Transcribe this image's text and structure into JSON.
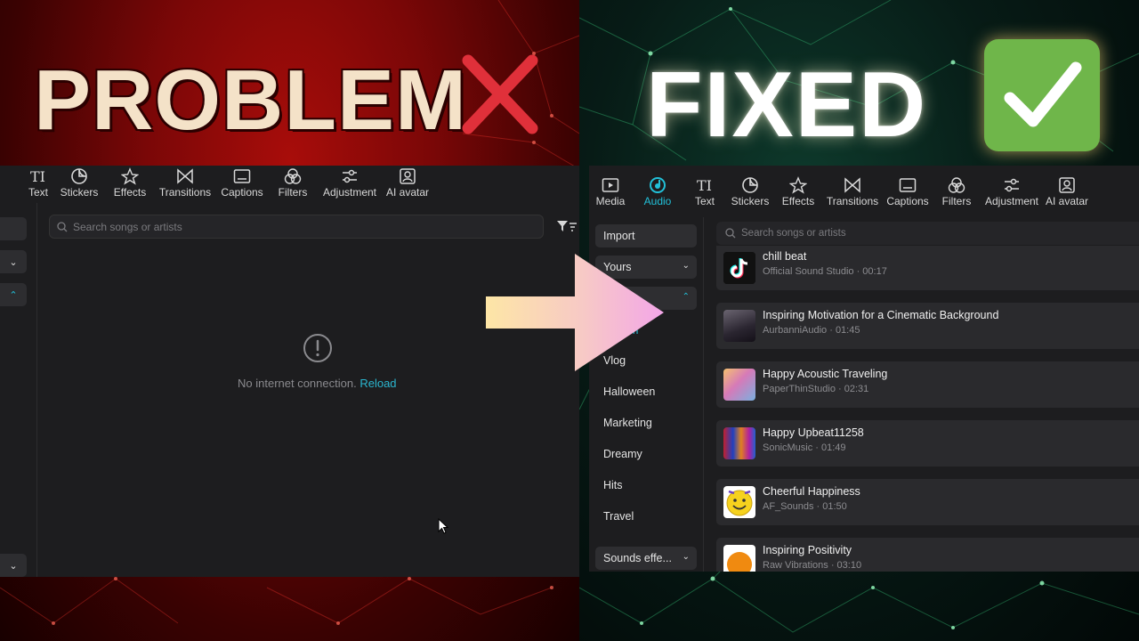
{
  "colors": {
    "problem_bg": "#8a0808",
    "fixed_bg": "#0a2a20",
    "accent_cyan": "#22c0d8",
    "problem_text": "#f4e2c8",
    "x_red": "#e0303a",
    "check_green": "#6fb64a"
  },
  "headline": {
    "problem": "PROBLEM",
    "fixed": "FIXED",
    "problem_icon": "red-x-icon",
    "fixed_icon": "green-check-icon"
  },
  "left_panel": {
    "tools": [
      {
        "label": "Text",
        "icon": "text-icon"
      },
      {
        "label": "Stickers",
        "icon": "sticker-icon"
      },
      {
        "label": "Effects",
        "icon": "sparkle-icon"
      },
      {
        "label": "Transitions",
        "icon": "transition-icon"
      },
      {
        "label": "Captions",
        "icon": "captions-icon"
      },
      {
        "label": "Filters",
        "icon": "filters-icon"
      },
      {
        "label": "Adjustment",
        "icon": "adjustment-icon"
      },
      {
        "label": "AI avatar",
        "icon": "avatar-icon"
      }
    ],
    "search_placeholder": "Search songs or artists",
    "error_message": "No internet connection.",
    "reload_link": "Reload"
  },
  "right_panel": {
    "tools": [
      {
        "label": "Media",
        "icon": "media-icon",
        "active": false
      },
      {
        "label": "Audio",
        "icon": "audio-icon",
        "active": true
      },
      {
        "label": "Text",
        "icon": "text-icon",
        "active": false
      },
      {
        "label": "Stickers",
        "icon": "sticker-icon",
        "active": false
      },
      {
        "label": "Effects",
        "icon": "sparkle-icon",
        "active": false
      },
      {
        "label": "Transitions",
        "icon": "transition-icon",
        "active": false
      },
      {
        "label": "Captions",
        "icon": "captions-icon",
        "active": false
      },
      {
        "label": "Filters",
        "icon": "filters-icon",
        "active": false
      },
      {
        "label": "Adjustment",
        "icon": "adjustment-icon",
        "active": false
      },
      {
        "label": "AI avatar",
        "icon": "avatar-icon",
        "active": false
      }
    ],
    "sidebar": {
      "import": "Import",
      "yours": "Yours",
      "partial_item": "gm",
      "categories": [
        "Vlog",
        "Halloween",
        "Marketing",
        "Dreamy",
        "Hits",
        "Travel"
      ],
      "sounds_effects": "Sounds effe..."
    },
    "search_placeholder": "Search songs or artists",
    "songs": [
      {
        "title": "chill beat",
        "meta": "Official Sound Studio · 00:17"
      },
      {
        "title": "Inspiring Motivation for a Cinematic Background",
        "meta": "AurbanniAudio · 01:45"
      },
      {
        "title": "Happy Acoustic Traveling",
        "meta": "PaperThinStudio · 02:31"
      },
      {
        "title": "Happy Upbeat11258",
        "meta": "SonicMusic · 01:49"
      },
      {
        "title": "Cheerful Happiness",
        "meta": "AF_Sounds · 01:50"
      },
      {
        "title": "Inspiring Positivity",
        "meta": "Raw Vibrations · 03:10"
      }
    ]
  }
}
